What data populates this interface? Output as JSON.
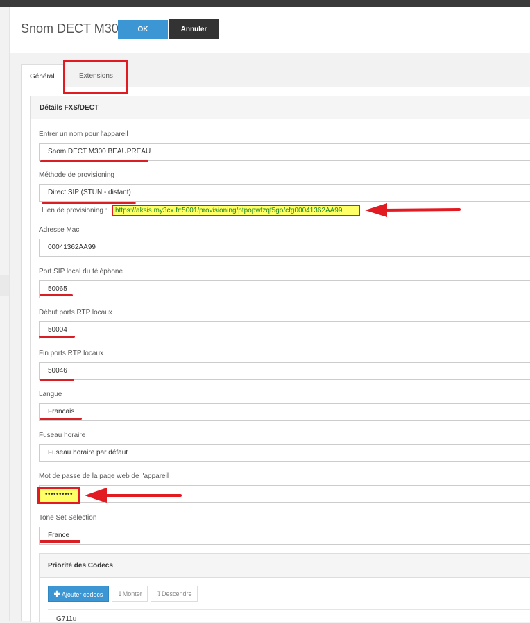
{
  "header": {
    "title": "Snom DECT M300",
    "ok_label": "OK",
    "cancel_label": "Annuler"
  },
  "tabs": [
    {
      "label": "Général",
      "active": true
    },
    {
      "label": "Extensions",
      "active": false
    }
  ],
  "panel": {
    "title": "Détails FXS/DECT"
  },
  "fields": {
    "device_name": {
      "label": "Entrer un nom pour l'appareil",
      "value": "Snom DECT M300 BEAUPREAU"
    },
    "provisioning_method": {
      "label": "Méthode de provisioning",
      "value": "Direct SIP (STUN - distant)"
    },
    "provisioning_link": {
      "label": "Lien de provisioning :",
      "value": "https://aksis.my3cx.fr:5001/provisioning/ptpopwfzqf5go/cfg00041362AA99"
    },
    "mac": {
      "label": "Adresse Mac",
      "value": "00041362AA99"
    },
    "sip_port": {
      "label": "Port SIP local du téléphone",
      "value": "50065"
    },
    "rtp_start": {
      "label": "Début ports RTP locaux",
      "value": "50004"
    },
    "rtp_end": {
      "label": "Fin ports RTP locaux",
      "value": "50046"
    },
    "language": {
      "label": "Langue",
      "value": "Francais"
    },
    "timezone": {
      "label": "Fuseau horaire",
      "value": "Fuseau horaire par défaut"
    },
    "web_password": {
      "label": "Mot de passe de la page web de l'appareil",
      "value": "••••••••••"
    },
    "tone_set": {
      "label": "Tone Set Selection",
      "value": "France"
    }
  },
  "codecs": {
    "title": "Priorité des Codecs",
    "add_label": "Ajouter codecs",
    "up_label": "Monter",
    "down_label": "Descendre",
    "items": [
      "G711u"
    ]
  },
  "colors": {
    "primary": "#3c96d3",
    "dark_button": "#333333",
    "annotation_red": "#e21b23",
    "highlight_yellow": "#ffff66",
    "link_green": "#1a8a2a"
  }
}
